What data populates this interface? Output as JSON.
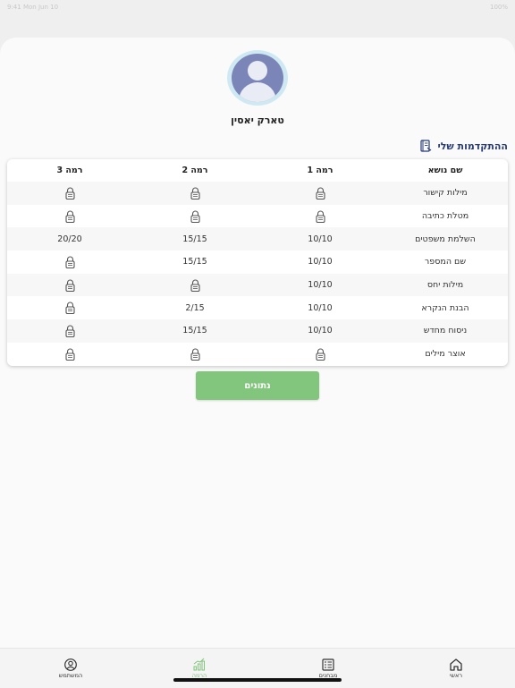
{
  "status_bar": {
    "time": "9:41",
    "date": "Mon Jun 10",
    "battery": "100%"
  },
  "user": {
    "name": "טארק יאסין"
  },
  "progress": {
    "title": "ההתקדמות שלי"
  },
  "table": {
    "headers": [
      "שם נושא",
      "רמה 1",
      "רמה 2",
      "רמה 3"
    ],
    "rows": [
      [
        "מילות קישור",
        "lock",
        "lock",
        "lock"
      ],
      [
        "מטלת כתיבה",
        "lock",
        "lock",
        "lock"
      ],
      [
        "השלמת משפטים",
        "10/10",
        "15/15",
        "20/20"
      ],
      [
        "שם המספר",
        "10/10",
        "15/15",
        "lock"
      ],
      [
        "מילות יחס",
        "10/10",
        "lock",
        "lock"
      ],
      [
        "הבנת הנקרא",
        "10/10",
        "2/15",
        "lock"
      ],
      [
        "ניסוח מחדש",
        "10/10",
        "15/15",
        "lock"
      ],
      [
        "אוצר מילים",
        "lock",
        "lock",
        "lock"
      ]
    ]
  },
  "data_button": {
    "label": "נתונים"
  },
  "nav": {
    "home": "ראשי",
    "exams": "מבחנים",
    "progress": "הרמה",
    "user": "המשתמש"
  },
  "colors": {
    "accent": "#82c57c",
    "title": "#263a75",
    "avatar": "#7b85b8"
  }
}
